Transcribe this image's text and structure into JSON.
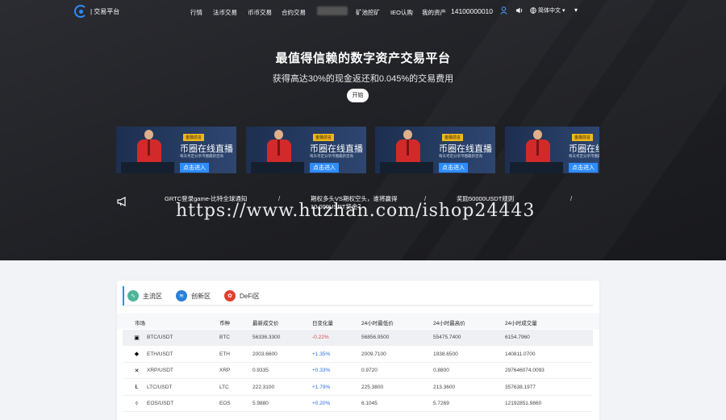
{
  "colors": {
    "accent": "#2d8cff",
    "up": "#2d6cdf",
    "down": "#e84a4a",
    "hero_bg": "#1f2024"
  },
  "nav": {
    "logo_text": "| 交易平台",
    "items": [
      "行情",
      "法币交易",
      "币币交易",
      "合约交易",
      "矿池挖矿",
      "IEO认购",
      "我的资产"
    ],
    "phone": "14100000010",
    "language": "简体中文",
    "icons": [
      "user-icon",
      "volume-icon",
      "globe-icon",
      "chevron-down-icon"
    ]
  },
  "hero": {
    "title": "最值得信赖的数字资产交易平台",
    "subtitle": "获得高达30%的现金返还和0.045%的交易费用",
    "start_label": "开始"
  },
  "banners": [
    {
      "tag": "金融前言",
      "title": "币圈在线直播",
      "sub": "每天考定分享币圈最新咨询",
      "cta": "点击进入"
    },
    {
      "tag": "金融前言",
      "title": "币圈在线直播",
      "sub": "每天考定分享币圈最新咨询",
      "cta": "点击进入"
    },
    {
      "tag": "金融前言",
      "title": "币圈在线直播",
      "sub": "每天考定分享币圈最新咨询",
      "cta": "点击进入"
    },
    {
      "tag": "金融前言",
      "title": "币圈在线直播",
      "sub": "每天考定分享币圈最新咨询",
      "cta": "点击进入"
    }
  ],
  "notices": [
    {
      "line1": "GRTC登录game-比特全球通知",
      "line2": ""
    },
    {
      "line1": "期权多头VS期权空头，谁将赢得",
      "line2": "10,000USDT奖金？"
    },
    {
      "line1": "奖励50000USDT规则",
      "line2": ""
    }
  ],
  "notice_sep": "/",
  "watermark": "https://www.huzhan.com/ishop24443",
  "market": {
    "tabs": [
      {
        "label": "主流区",
        "icon": "wave-icon"
      },
      {
        "label": "创新区",
        "icon": "layers-icon"
      },
      {
        "label": "DeFi区",
        "icon": "defi-icon"
      }
    ],
    "columns": [
      "市场",
      "币种",
      "最新成交价",
      "日变化量",
      "24小时最低价",
      "24小时最高价",
      "24小时成交量"
    ],
    "rows": [
      {
        "pair": "BTC/USDT",
        "coin": "BTC",
        "price": "56336.3300",
        "change": "-0.22%",
        "dir": "down",
        "low": "56856.9500",
        "high": "55475.7400",
        "vol": "6154.7960",
        "icon": "btc-icon"
      },
      {
        "pair": "ETH/USDT",
        "coin": "ETH",
        "price": "2003.6600",
        "change": "+1.35%",
        "dir": "up",
        "low": "2009.7100",
        "high": "1938.6500",
        "vol": "140811.0700",
        "icon": "eth-icon"
      },
      {
        "pair": "XRP/USDT",
        "coin": "XRP",
        "price": "0.9335",
        "change": "+0.33%",
        "dir": "up",
        "low": "0.9720",
        "high": "0.8800",
        "vol": "297646074.0093",
        "icon": "xrp-icon"
      },
      {
        "pair": "LTC/USDT",
        "coin": "LTC",
        "price": "222.3100",
        "change": "+1.79%",
        "dir": "up",
        "low": "225.3800",
        "high": "213.3600",
        "vol": "357638.1977",
        "icon": "ltc-icon"
      },
      {
        "pair": "EOS/USDT",
        "coin": "EOS",
        "price": "5.9880",
        "change": "+0.20%",
        "dir": "up",
        "low": "6.1045",
        "high": "5.7269",
        "vol": "12192851.9860",
        "icon": "eos-icon"
      }
    ]
  }
}
